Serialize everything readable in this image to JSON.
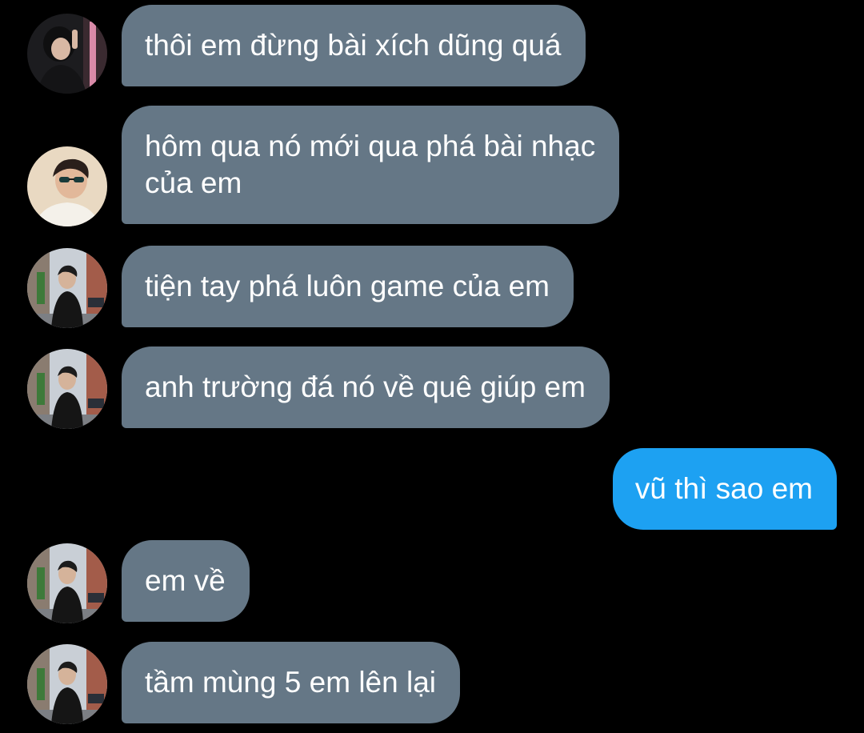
{
  "conversation": {
    "colors": {
      "background": "#000000",
      "incoming_bubble": "#657786",
      "outgoing_bubble": "#1da1f2",
      "text": "#ffffff"
    },
    "messages": [
      {
        "direction": "incoming",
        "avatar": "avatar-icon-girl-dark",
        "text": "thôi em đừng bài xích dũng quá"
      },
      {
        "direction": "incoming",
        "avatar": "avatar-icon-boy-sunglasses",
        "text": "hôm qua nó mới qua phá bài nhạc\ncủa em"
      },
      {
        "direction": "incoming",
        "avatar": "avatar-icon-boy-street",
        "text": "tiện tay phá luôn game của em"
      },
      {
        "direction": "incoming",
        "avatar": "avatar-icon-boy-street",
        "text": "anh trường đá nó về quê giúp em"
      },
      {
        "direction": "outgoing",
        "text": "vũ thì sao em"
      },
      {
        "direction": "incoming",
        "avatar": "avatar-icon-boy-street",
        "text": "em về"
      },
      {
        "direction": "incoming",
        "avatar": "avatar-icon-boy-street",
        "text": "tầm mùng 5 em lên lại"
      }
    ]
  }
}
